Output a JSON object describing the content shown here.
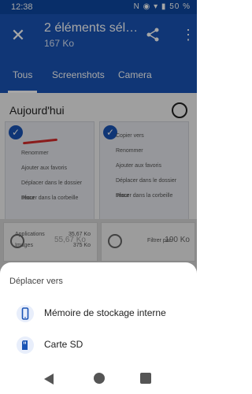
{
  "status_bar": {
    "time": "12:38",
    "battery": "50 %",
    "icons_text": "N ◉ ▾ ▮"
  },
  "app_bar": {
    "title": "2 éléments sélec…",
    "subtitle": "167 Ko"
  },
  "tabs": [
    {
      "label": "Tous",
      "active": true
    },
    {
      "label": "Screenshots",
      "active": false
    },
    {
      "label": "Camera",
      "active": false
    }
  ],
  "section": {
    "title": "Aujourd'hui"
  },
  "card_left": {
    "items": [
      "Renommer",
      "Ajouter aux favoris",
      "Déplacer dans le dossier sécur",
      "Placer dans la corbeille"
    ]
  },
  "card_right": {
    "items": [
      "Copier vers",
      "Renommer",
      "Ajouter aux favoris",
      "Déplacer dans le dossier sécur",
      "Placer dans la corbeille"
    ]
  },
  "thumbnails": {
    "left_rows": [
      "Applications",
      "Images"
    ],
    "left_values": [
      "35,67 Ko",
      "375 Ko"
    ],
    "left_size": "55,67 Ko",
    "right_text": "Filtrer par",
    "right_size": "190 Ko"
  },
  "bottom_sheet": {
    "title": "Déplacer vers",
    "options": [
      {
        "label": "Mémoire de stockage interne",
        "icon": "phone-icon"
      },
      {
        "label": "Carte SD",
        "icon": "sd-card-icon"
      }
    ]
  },
  "colors": {
    "primary": "#1a54b5",
    "statusbar": "#0d47a1",
    "accent_red": "#d52b2b"
  }
}
